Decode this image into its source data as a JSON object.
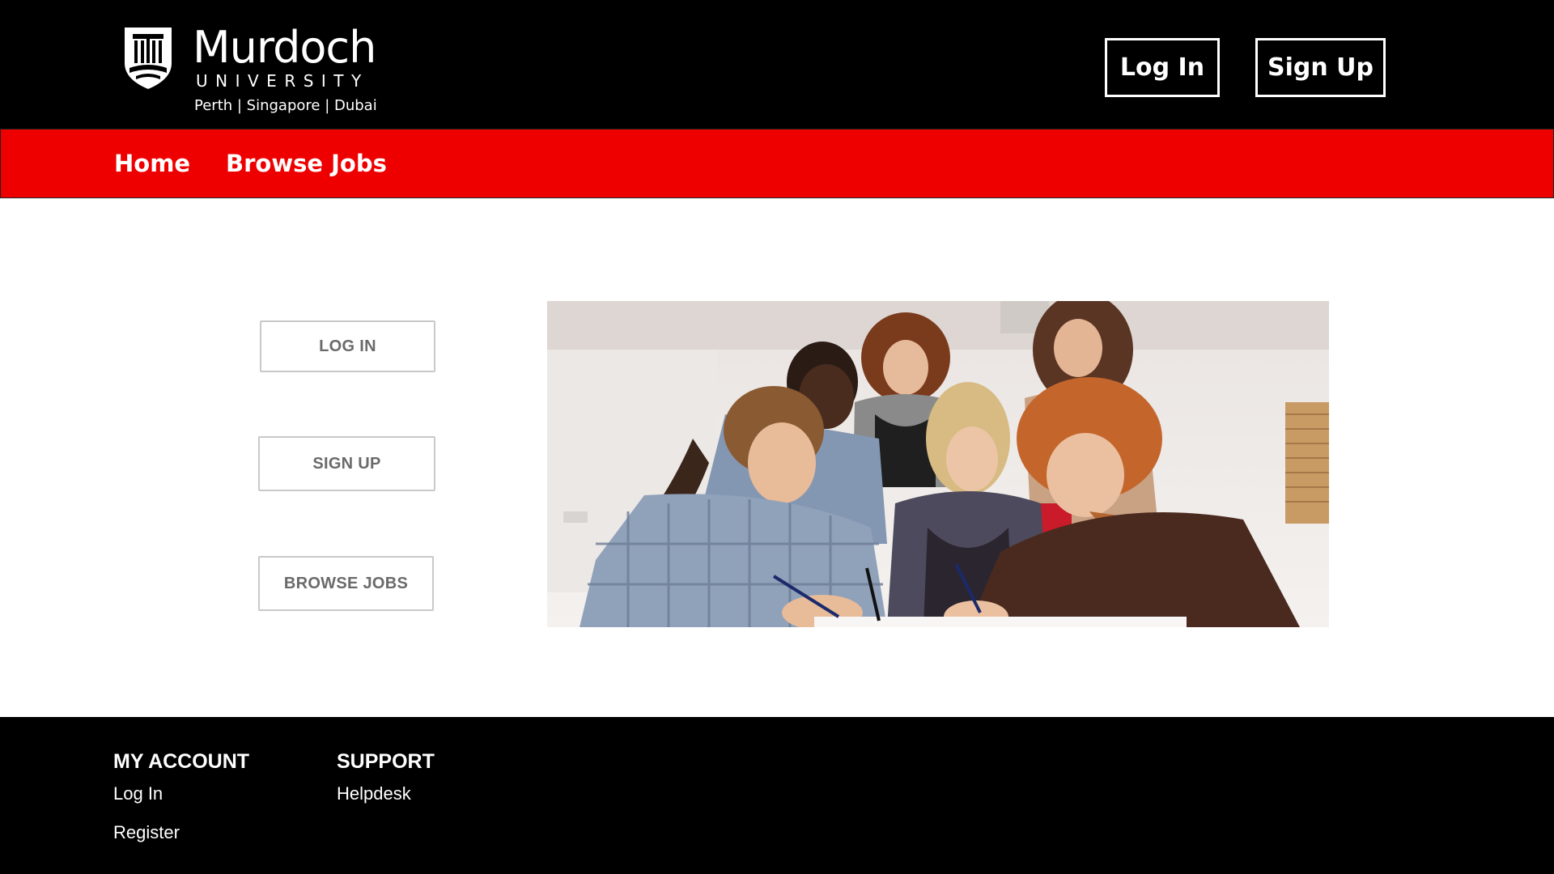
{
  "header": {
    "logo": {
      "wordmark": "Murdoch",
      "subtitle": "UNIVERSITY",
      "campuses": "Perth | Singapore | Dubai",
      "icon": "murdoch-crest-icon"
    },
    "login_label": "Log In",
    "signup_label": "Sign Up"
  },
  "nav": {
    "items": [
      {
        "label": "Home"
      },
      {
        "label": "Browse Jobs"
      }
    ]
  },
  "main": {
    "buttons": {
      "login": "LOG IN",
      "signup": "SIGN UP",
      "browse": "BROWSE JOBS"
    },
    "hero_image": "students-group-writing-photo"
  },
  "footer": {
    "my_account": {
      "heading": "MY ACCOUNT",
      "links": [
        "Log In",
        "Register"
      ]
    },
    "support": {
      "heading": "SUPPORT",
      "links": [
        "Helpdesk"
      ]
    }
  },
  "colors": {
    "header_bg": "#000000",
    "nav_bg": "#ee0000",
    "footer_bg": "#000000",
    "button_text": "#6a6a6a",
    "button_border": "#c9c9c9"
  }
}
